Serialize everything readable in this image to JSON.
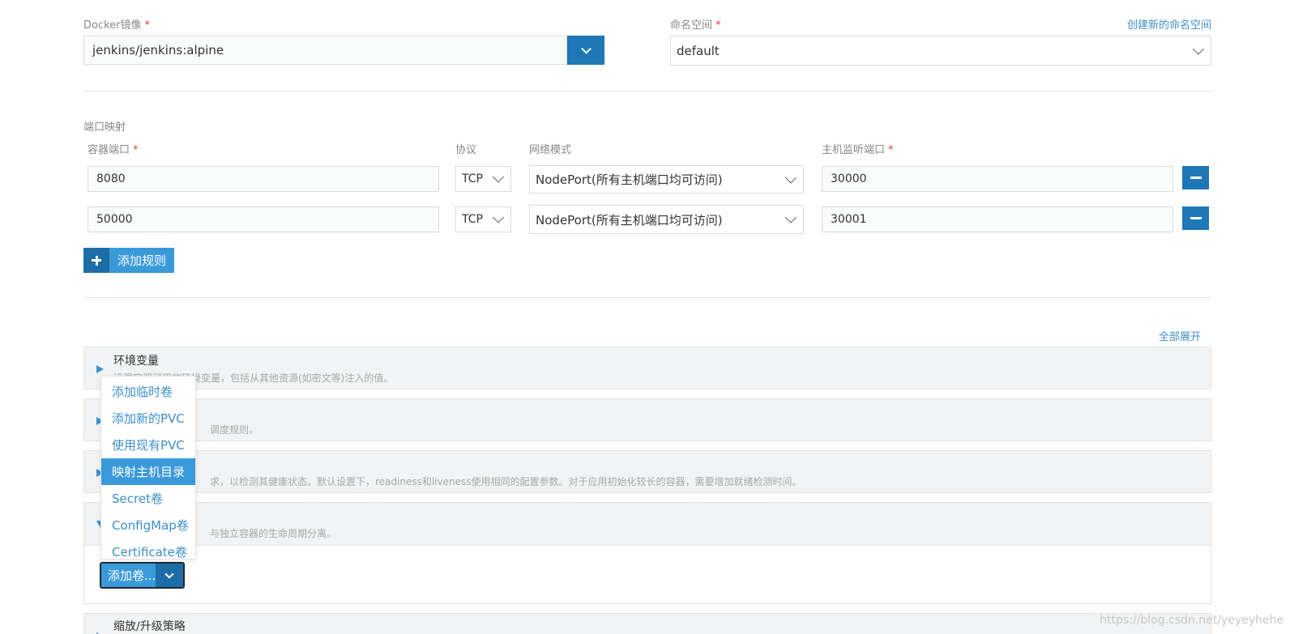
{
  "image": {
    "label": "Docker镜像",
    "required": "*",
    "value": "jenkins/jenkins:alpine",
    "toggle_icon": "chevron-down-icon"
  },
  "namespace": {
    "label": "命名空间",
    "required": "*",
    "create_link": "创建新的命名空间",
    "value": "default"
  },
  "ports": {
    "section_label": "端口映射",
    "headers": {
      "container_port": "容器端口",
      "protocol": "协议",
      "network_mode": "网络模式",
      "host_port": "主机监听端口",
      "required": "*"
    },
    "rows": [
      {
        "container_port": "8080",
        "protocol": "TCP",
        "network_mode": "NodePort(所有主机端口均可访问)",
        "host_port": "30000"
      },
      {
        "container_port": "50000",
        "protocol": "TCP",
        "network_mode": "NodePort(所有主机端口均可访问)",
        "host_port": "30001"
      }
    ],
    "add_rule_label": "添加规则"
  },
  "expand_all_label": "全部展开",
  "panels": [
    {
      "title": "环境变量",
      "desc": "设置容器可用的环境变量，包括从其他资源(如密文等)注入的值。"
    },
    {
      "title": "",
      "desc": "调度规则。"
    },
    {
      "title": "",
      "desc": "求，以检测其健康状态。默认设置下，readiness和liveness使用相同的配置参数。对于应用初始化较长的容器，需要增加就绪检测时间。"
    },
    {
      "title": "",
      "desc": "与独立容器的生命周期分离。"
    },
    {
      "title": "缩放/升级策略",
      "desc": ""
    }
  ],
  "volume_menu": {
    "items": [
      "添加临时卷",
      "添加新的PVC",
      "使用现有PVC",
      "映射主机目录",
      "Secret卷",
      "ConfigMap卷",
      "Certificate卷"
    ],
    "active_index": 3,
    "button_label": "添加卷..."
  },
  "watermark": "https://blog.csdn.net/yeyeyhehe",
  "colors": {
    "accent": "#3a9ad9",
    "accent_dark": "#1d78b5",
    "link": "#3d8fc7",
    "required": "#e03c3c"
  }
}
